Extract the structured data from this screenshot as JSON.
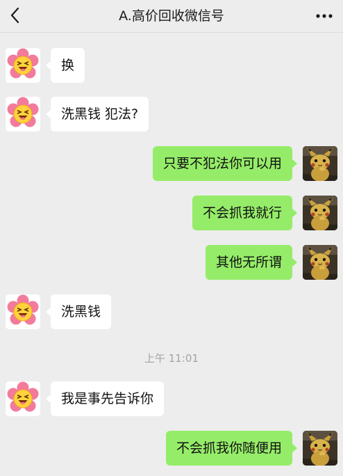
{
  "header": {
    "title": "A.高价回收微信号",
    "back_icon": "chevron-left-icon",
    "more_icon": "more-dots-icon"
  },
  "colors": {
    "background": "#ededed",
    "incoming_bubble": "#ffffff",
    "outgoing_bubble": "#95ec69",
    "timestamp_text": "#a3a3a3"
  },
  "contact_avatar_icon": "flower-emoji-avatar-icon",
  "self_avatar_icon": "pikachu-photo-avatar-icon",
  "messages": [
    {
      "sender": "contact",
      "text": "换"
    },
    {
      "sender": "contact",
      "text": "洗黑钱 犯法?"
    },
    {
      "sender": "self",
      "text": "只要不犯法你可以用"
    },
    {
      "sender": "self",
      "text": "不会抓我就行"
    },
    {
      "sender": "self",
      "text": "其他无所谓"
    },
    {
      "sender": "contact",
      "text": "洗黑钱"
    },
    {
      "sender": "contact",
      "text": "我是事先告诉你"
    },
    {
      "sender": "self",
      "text": "不会抓我你随便用"
    }
  ],
  "timestamp": "上午 11:01"
}
